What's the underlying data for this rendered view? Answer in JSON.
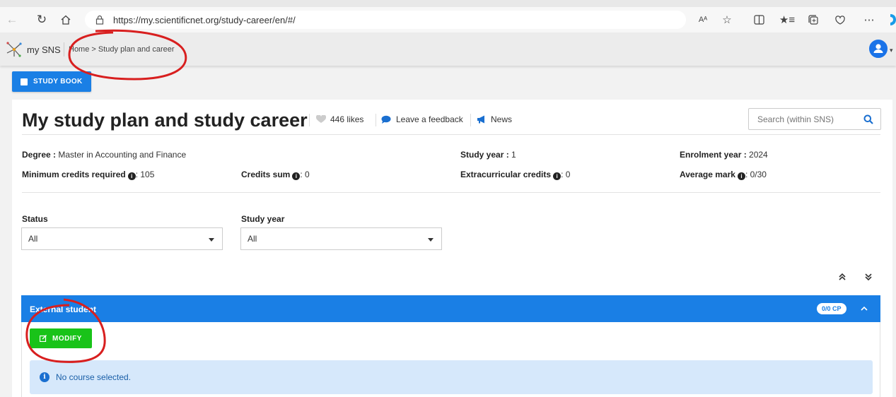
{
  "browser": {
    "url": "https://my.scientificnet.org/study-career/en/#/",
    "reader_icon_text": "Aᴬ"
  },
  "header": {
    "brand": "my SNS",
    "breadcrumb": "Home > Study plan and career"
  },
  "toolbar": {
    "study_book_label": "STUDY BOOK"
  },
  "page": {
    "title": "My study plan and study career",
    "likes": "446 likes",
    "feedback": "Leave a feedback",
    "news": "News",
    "search_placeholder": "Search (within SNS)"
  },
  "info": {
    "degree_label": "Degree :",
    "degree_value": " Master in Accounting and Finance",
    "study_year_label": "Study year :",
    "study_year_value": " 1",
    "enrolment_year_label": "Enrolment year :",
    "enrolment_year_value": " 2024",
    "min_credits_label": "Minimum credits required",
    "min_credits_value": ": 105",
    "credits_sum_label": "Credits sum",
    "credits_sum_value": ": 0",
    "extra_credits_label": "Extracurricular credits",
    "extra_credits_value": ": 0",
    "avg_mark_label": "Average mark",
    "avg_mark_value": ": 0/30"
  },
  "filters": {
    "status_label": "Status",
    "status_value": "All",
    "study_year_label": "Study year",
    "study_year_value": "All"
  },
  "panel": {
    "title": "External student",
    "badge": "0/0 CP",
    "modify_label": "MODIFY",
    "alert_text": "No course selected."
  },
  "colors": {
    "primary": "#1a7fe5",
    "success": "#19c319",
    "alert_bg": "#d6e8fb",
    "annotation": "#d81f1f"
  },
  "icons": [
    "back-icon",
    "reload-icon",
    "home-icon",
    "lock-icon",
    "read-aloud-icon",
    "favorite-star-icon",
    "split-screen-icon",
    "favorites-icon",
    "collections-icon",
    "extensions-icon",
    "more-icon",
    "copilot-icon",
    "logo-icon",
    "user-icon",
    "book-icon",
    "heart-icon",
    "comment-icon",
    "megaphone-icon",
    "search-icon",
    "info-icon",
    "collapse-all-icon",
    "expand-all-icon",
    "chevron-up-icon",
    "edit-icon"
  ]
}
